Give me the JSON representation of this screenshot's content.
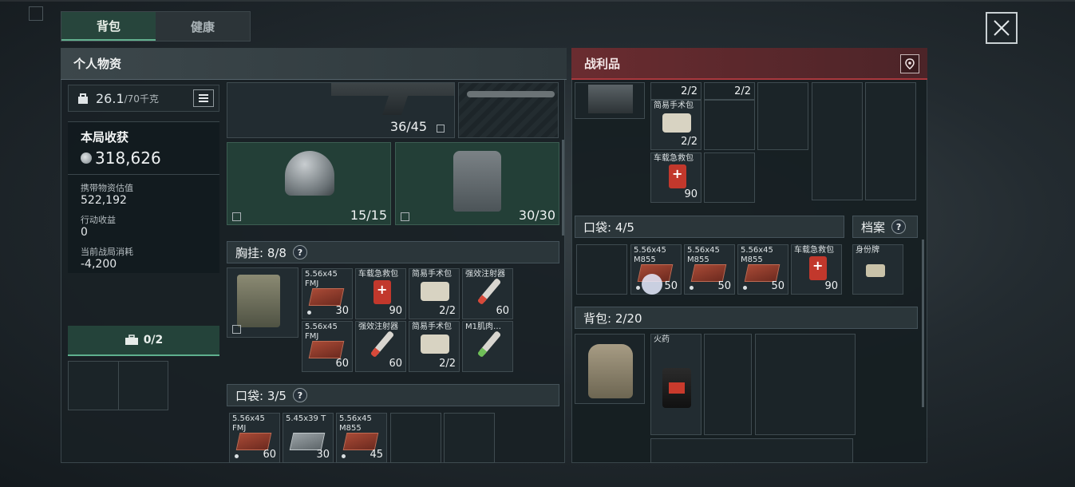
{
  "tabs": [
    {
      "label": "背包",
      "active": true
    },
    {
      "label": "健康",
      "active": false
    }
  ],
  "left": {
    "header": "个人物资",
    "weight": {
      "value": "26.1",
      "max": "/70千克"
    },
    "stats": {
      "title": "本局收获",
      "harvest": "318,626",
      "carried_label": "携带物资估值",
      "carried_value": "522,192",
      "action_label": "行动收益",
      "action_value": "0",
      "cost_label": "当前战局消耗",
      "cost_value": "-4,200"
    },
    "case": {
      "label": "0/2"
    },
    "weapon": {
      "count": "36/45"
    },
    "helmet": {
      "count": "15/15"
    },
    "armor": {
      "count": "30/30"
    },
    "chest_rig": {
      "title": "胸挂: 8/8",
      "help": "?"
    },
    "chest_items": [
      {
        "name": "5.56x45 FMJ",
        "count": "30"
      },
      {
        "name": "车载急救包",
        "count": "90"
      },
      {
        "name": "简易手术包",
        "count": "2/2"
      },
      {
        "name": "强效注射器",
        "count": "60"
      },
      {
        "name": "5.56x45 FMJ",
        "count": "60"
      },
      {
        "name": "强效注射器",
        "count": "60"
      },
      {
        "name": "简易手术包",
        "count": "2/2"
      },
      {
        "name": "M1肌肉…",
        "count": ""
      }
    ],
    "pocket": {
      "title": "口袋: 3/5",
      "help": "?"
    },
    "pocket_items": [
      {
        "name": "5.56x45 FMJ",
        "count": "60"
      },
      {
        "name": "5.45x39 T",
        "count": "30"
      },
      {
        "name": "5.56x45 M855",
        "count": "45"
      }
    ]
  },
  "right": {
    "header": "战利品",
    "loot_top": [
      {
        "name": "",
        "count": "2/2"
      },
      {
        "name": "",
        "count": "2/2"
      },
      {
        "name": "简易手术包",
        "count": "2/2"
      },
      {
        "name": "车载急救包",
        "count": "90"
      }
    ],
    "pocket": {
      "title": "口袋: 4/5"
    },
    "archive": {
      "label": "档案",
      "help": "?"
    },
    "pocket_items": [
      {
        "name": "5.56x45 M855",
        "count": "50"
      },
      {
        "name": "5.56x45 M855",
        "count": "50"
      },
      {
        "name": "5.56x45 M855",
        "count": "50"
      },
      {
        "name": "车载急救包",
        "count": "90"
      },
      {
        "name": "身份牌",
        "count": ""
      }
    ],
    "backpack": {
      "title": "背包: 2/20"
    },
    "backpack_items": [
      {
        "name": "火药",
        "count": ""
      }
    ]
  }
}
